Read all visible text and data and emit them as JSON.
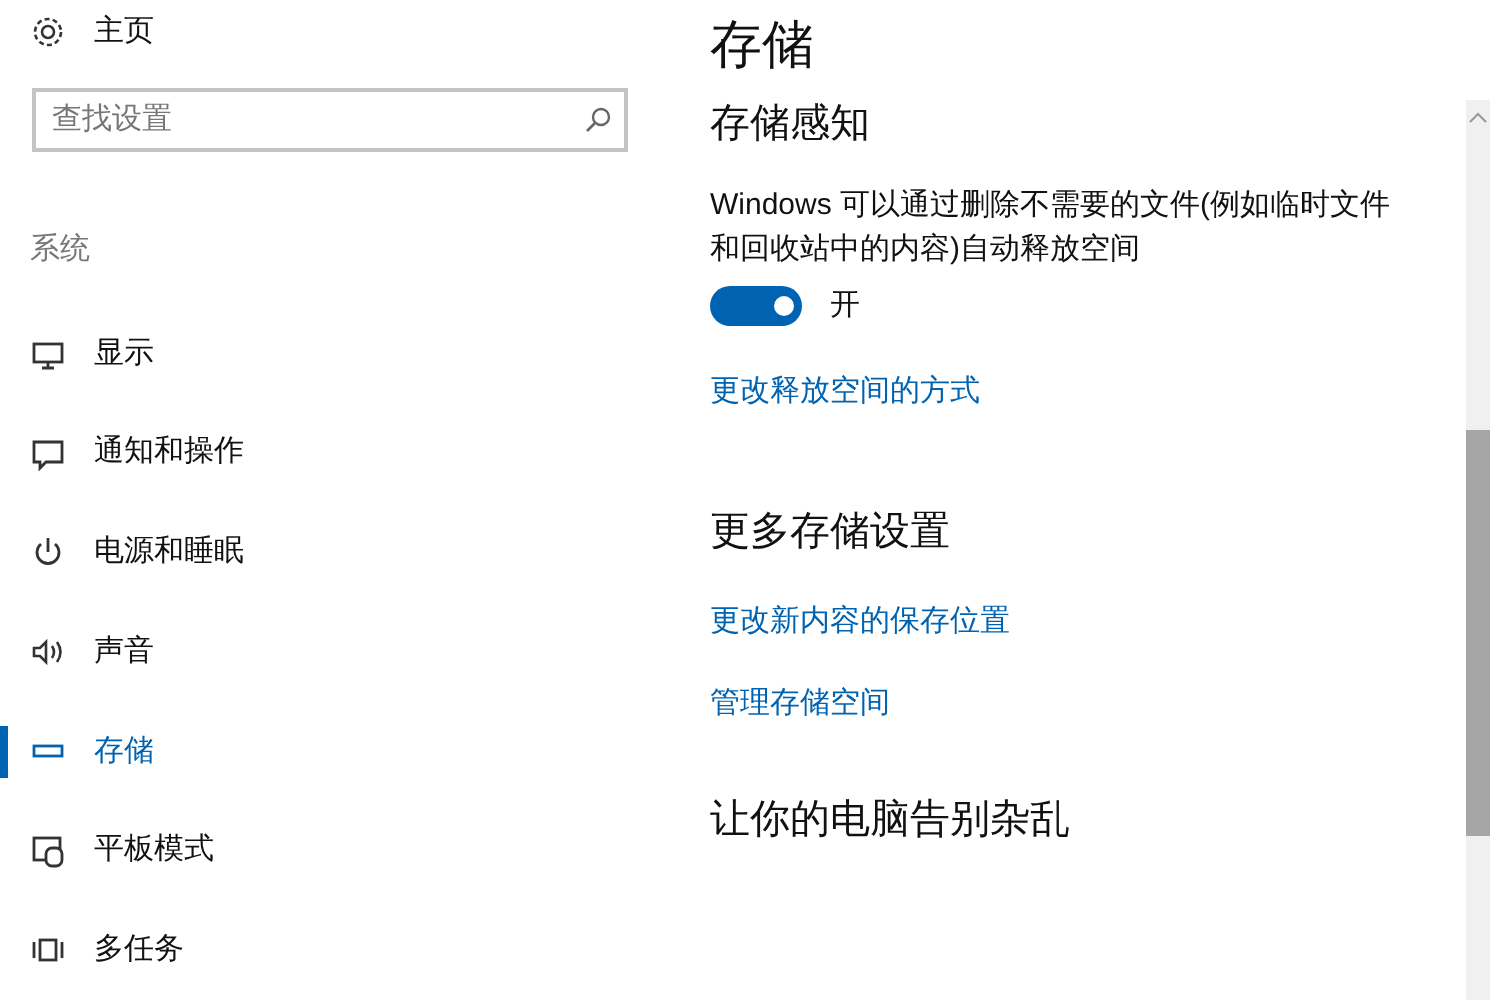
{
  "sidebar": {
    "home": {
      "label": "主页"
    },
    "search": {
      "placeholder": "查找设置"
    },
    "section": "系统",
    "items": [
      {
        "label": "显示",
        "kind": "monitor",
        "selected": false
      },
      {
        "label": "通知和操作",
        "kind": "bubble",
        "selected": false
      },
      {
        "label": "电源和睡眠",
        "kind": "power",
        "selected": false
      },
      {
        "label": "声音",
        "kind": "speaker",
        "selected": false
      },
      {
        "label": "存储",
        "kind": "storage",
        "selected": true
      },
      {
        "label": "平板模式",
        "kind": "tablet",
        "selected": false
      },
      {
        "label": "多任务",
        "kind": "multitask",
        "selected": false
      }
    ]
  },
  "content": {
    "title": "存储",
    "sections": [
      {
        "heading": "存储感知",
        "description": "Windows 可以通过删除不需要的文件(例如临时文件和回收站中的内容)自动释放空间",
        "toggle": {
          "on": true,
          "label": "开"
        },
        "links": [
          "更改释放空间的方式"
        ]
      },
      {
        "heading": "更多存储设置",
        "links": [
          "更改新内容的保存位置",
          "管理存储空间"
        ]
      },
      {
        "heading": "让你的电脑告别杂乱"
      }
    ]
  }
}
